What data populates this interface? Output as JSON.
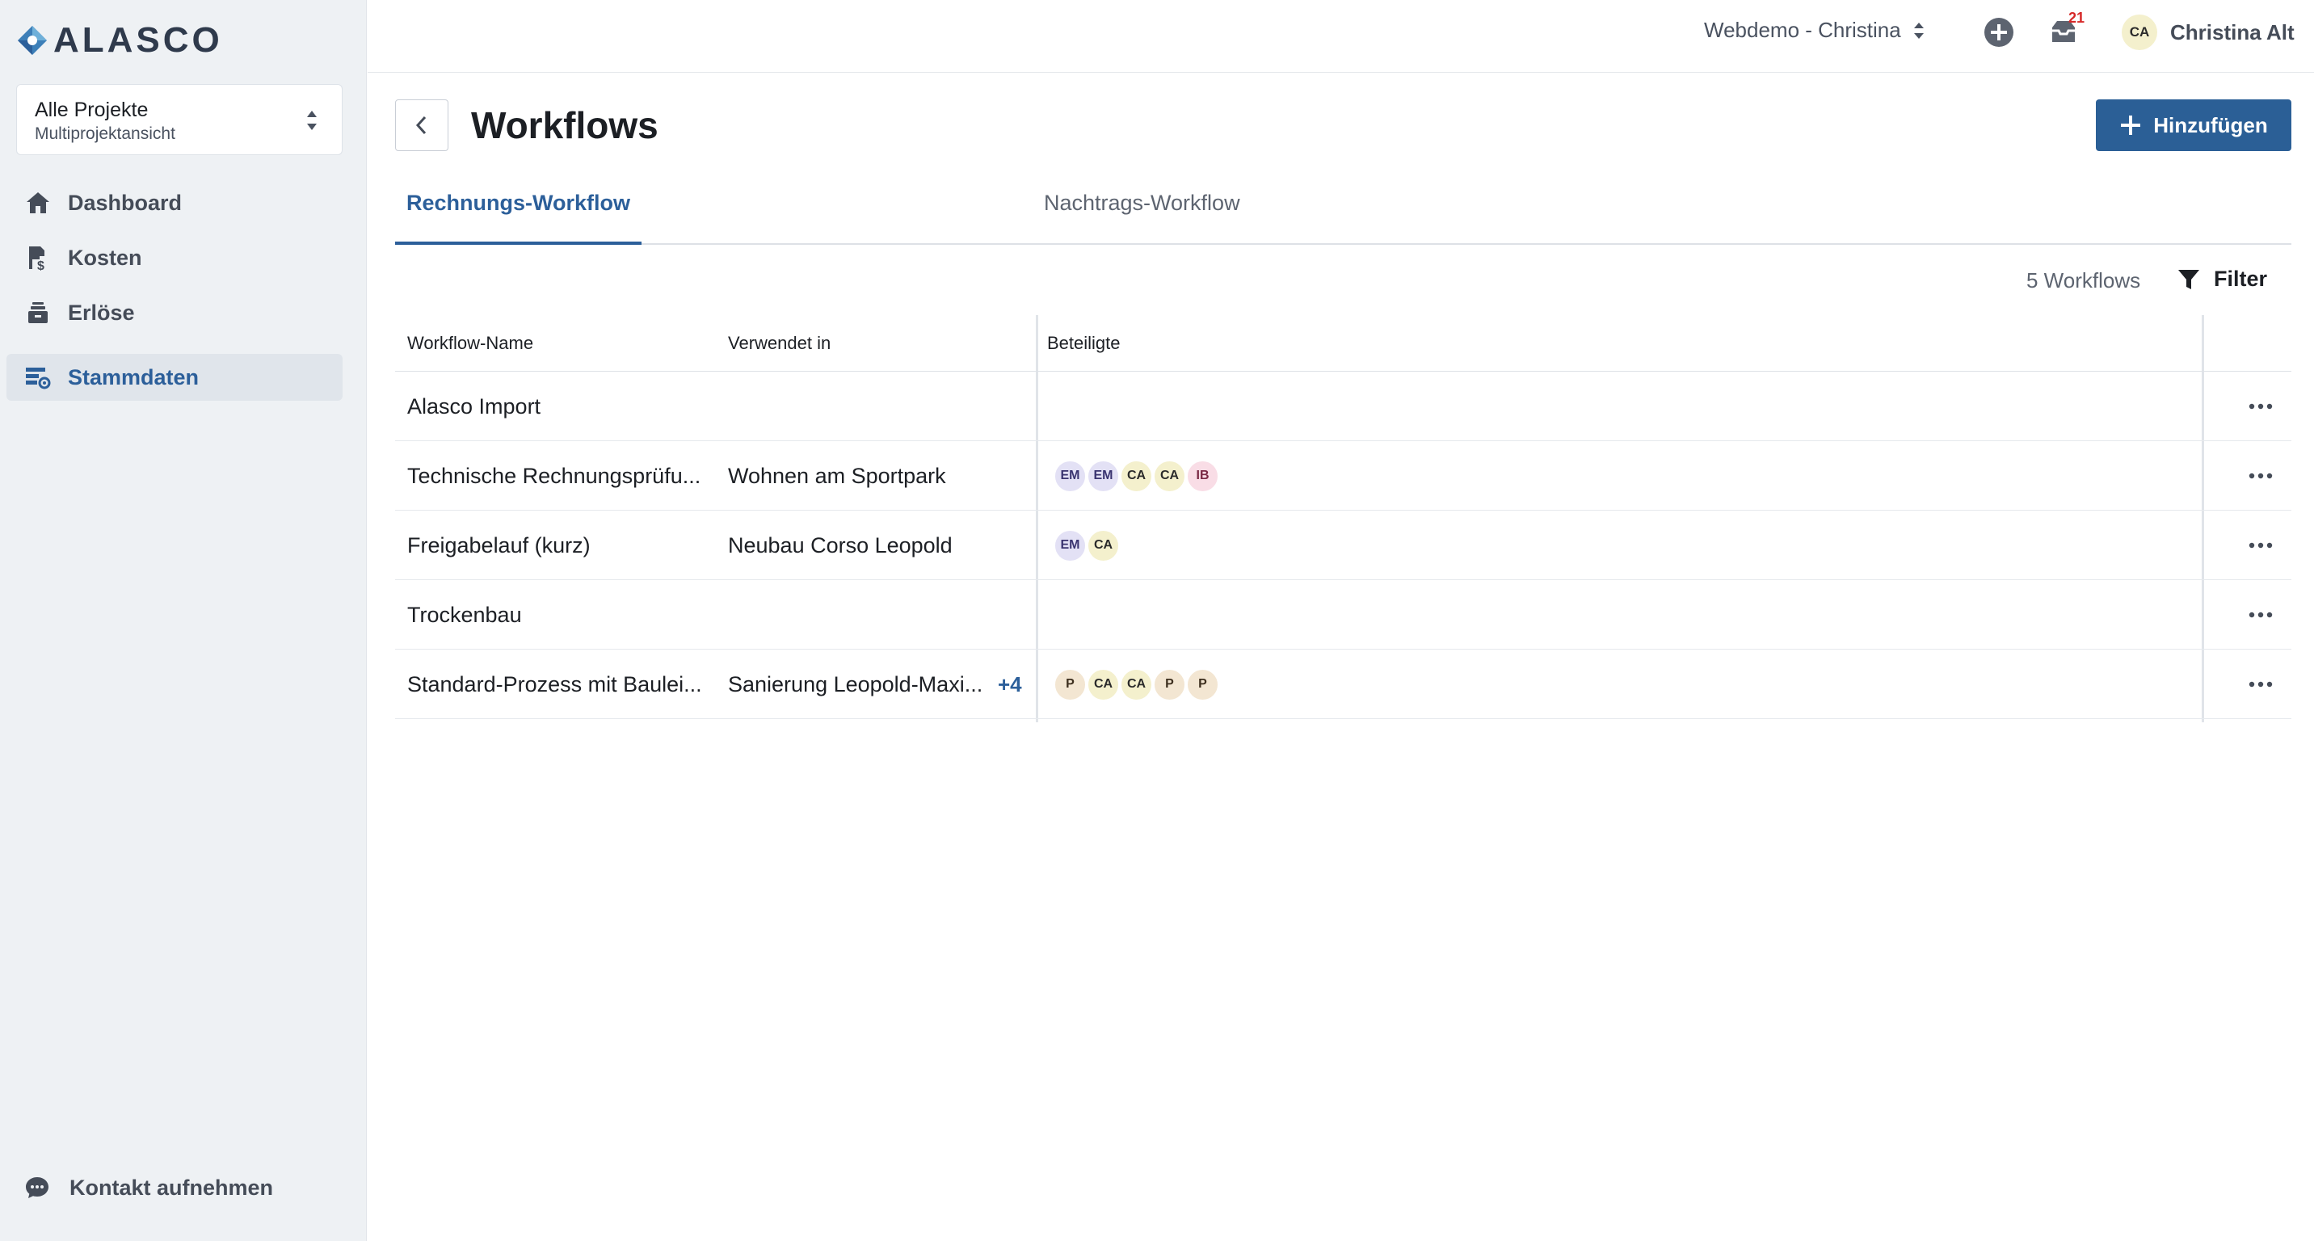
{
  "brand": {
    "logo_text": "ALASCO"
  },
  "project_select": {
    "name": "Alle Projekte",
    "subtitle": "Multiprojektansicht"
  },
  "sidebar": {
    "items": [
      {
        "label": "Dashboard",
        "icon": "home-icon",
        "active": false
      },
      {
        "label": "Kosten",
        "icon": "cost-icon",
        "active": false
      },
      {
        "label": "Erlöse",
        "icon": "revenue-icon",
        "active": false
      },
      {
        "label": "Stammdaten",
        "icon": "master-data-icon",
        "active": true
      }
    ],
    "contact_label": "Kontakt aufnehmen"
  },
  "topbar": {
    "org": "Webdemo - Christina",
    "inbox_count": "21",
    "user_initials": "CA",
    "user_name": "Christina Alt"
  },
  "header": {
    "title": "Workflows",
    "add_label": "Hinzufügen"
  },
  "tabs": [
    {
      "label": "Rechnungs-Workflow",
      "active": true
    },
    {
      "label": "Nachtrags-Workflow",
      "active": false
    }
  ],
  "summary": {
    "count": "5 Workflows",
    "filter_label": "Filter"
  },
  "table": {
    "columns": [
      "Workflow-Name",
      "Verwendet in",
      "Beteiligte"
    ],
    "rows": [
      {
        "name": "Alasco Import",
        "used_in": "",
        "more": "",
        "participants": []
      },
      {
        "name": "Technische Rechnungsprüfu...",
        "used_in": "Wohnen am Sportpark",
        "more": "",
        "participants": [
          "EM",
          "EM",
          "CA",
          "CA",
          "IB"
        ]
      },
      {
        "name": "Freigabelauf (kurz)",
        "used_in": "Neubau Corso Leopold",
        "more": "",
        "participants": [
          "EM",
          "CA"
        ]
      },
      {
        "name": "Trockenbau",
        "used_in": "",
        "more": "",
        "participants": []
      },
      {
        "name": "Standard-Prozess mit Baulei...",
        "used_in": "Sanierung Leopold-Maxi...",
        "more": "+4",
        "participants": [
          "P",
          "CA",
          "CA",
          "P",
          "P"
        ]
      }
    ]
  },
  "colors": {
    "accent": "#2b5f96",
    "sidebar_bg": "#eef1f4",
    "badge": "#d62828"
  }
}
